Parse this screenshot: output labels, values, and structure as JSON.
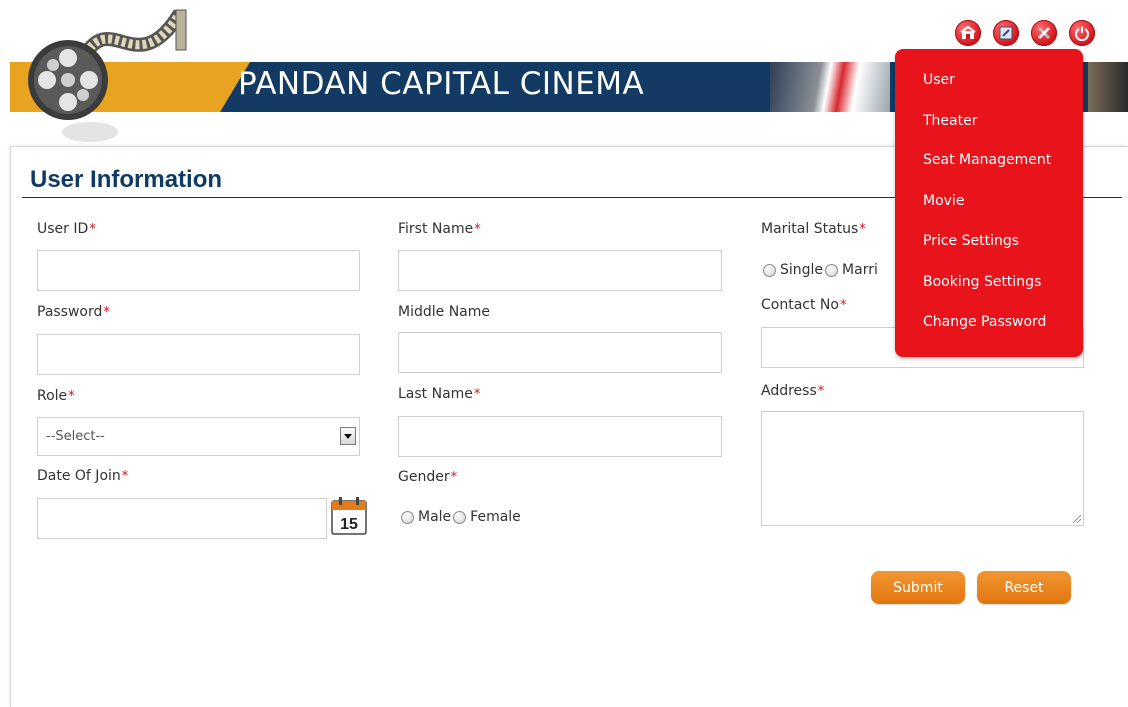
{
  "site": {
    "title": "PANDAN CAPITAL CINEMA"
  },
  "header_icons": [
    {
      "name": "home-icon"
    },
    {
      "name": "edit-icon"
    },
    {
      "name": "settings-tools-icon"
    },
    {
      "name": "power-icon"
    }
  ],
  "menu": {
    "items": [
      "User",
      "Theater",
      "Seat Management",
      "Movie",
      "Price Settings",
      "Booking Settings",
      "Change Password"
    ]
  },
  "form": {
    "title": "User Information",
    "required_marker": "*",
    "user_id": {
      "label": "User ID",
      "value": ""
    },
    "password": {
      "label": "Password",
      "value": ""
    },
    "role": {
      "label": "Role",
      "selected": "--Select--"
    },
    "date_of_join": {
      "label": "Date Of Join",
      "value": "",
      "calendar_day": "15"
    },
    "first_name": {
      "label": "First Name",
      "value": ""
    },
    "middle_name": {
      "label": "Middle Name",
      "value": ""
    },
    "last_name": {
      "label": "Last Name",
      "value": ""
    },
    "gender": {
      "label": "Gender",
      "options": [
        "Male",
        "Female"
      ]
    },
    "marital_status": {
      "label": "Marital Status",
      "options": [
        "Single",
        "Marri"
      ]
    },
    "contact_no": {
      "label": "Contact No",
      "value": ""
    },
    "address": {
      "label": "Address",
      "value": ""
    }
  },
  "buttons": {
    "submit": "Submit",
    "reset": "Reset"
  },
  "colors": {
    "brand_red": "#e8131b",
    "navy": "#0f3a66",
    "accent_orange": "#e8a320",
    "button_orange": "#e9821d"
  }
}
